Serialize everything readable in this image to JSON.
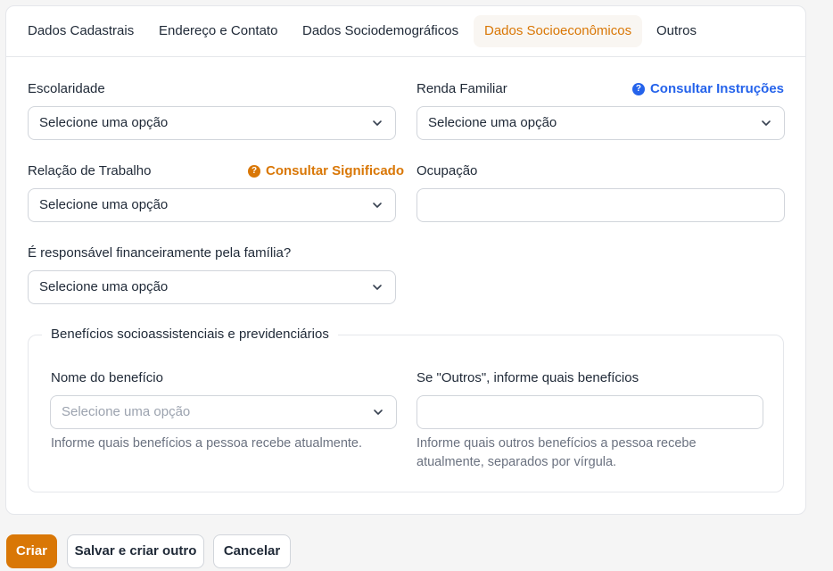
{
  "tabs": [
    {
      "label": "Dados Cadastrais"
    },
    {
      "label": "Endereço e Contato"
    },
    {
      "label": "Dados Sociodemográficos"
    },
    {
      "label": "Dados Socioeconômicos"
    },
    {
      "label": "Outros"
    }
  ],
  "form": {
    "escolaridade": {
      "label": "Escolaridade",
      "value": "Selecione uma opção"
    },
    "renda": {
      "label": "Renda Familiar",
      "value": "Selecione uma opção",
      "link": "Consultar Instruções"
    },
    "relacao": {
      "label": "Relação de Trabalho",
      "value": "Selecione uma opção",
      "link": "Consultar Significado"
    },
    "ocupacao": {
      "label": "Ocupação",
      "value": ""
    },
    "responsavel": {
      "label": "É responsável financeiramente pela família?",
      "value": "Selecione uma opção"
    },
    "question_icon": "?"
  },
  "beneficios": {
    "legend": "Benefícios socioassistenciais e previdenciários",
    "nome": {
      "label": "Nome do benefício",
      "placeholder": "Selecione uma opção",
      "help": "Informe quais benefícios a pessoa recebe atualmente."
    },
    "outros": {
      "label": "Se \"Outros\", informe quais benefícios",
      "value": "",
      "help": "Informe quais outros benefícios a pessoa recebe atualmente, separados por vírgula."
    }
  },
  "actions": {
    "create": "Criar",
    "save_another": "Salvar e criar outro",
    "cancel": "Cancelar"
  },
  "colors": {
    "accent": "#d97706",
    "link_blue": "#2563eb",
    "active_tab_bg": "#f9f6f2"
  },
  "icons": {
    "chevron": "chevron-down-icon",
    "help": "question-circle-icon"
  }
}
